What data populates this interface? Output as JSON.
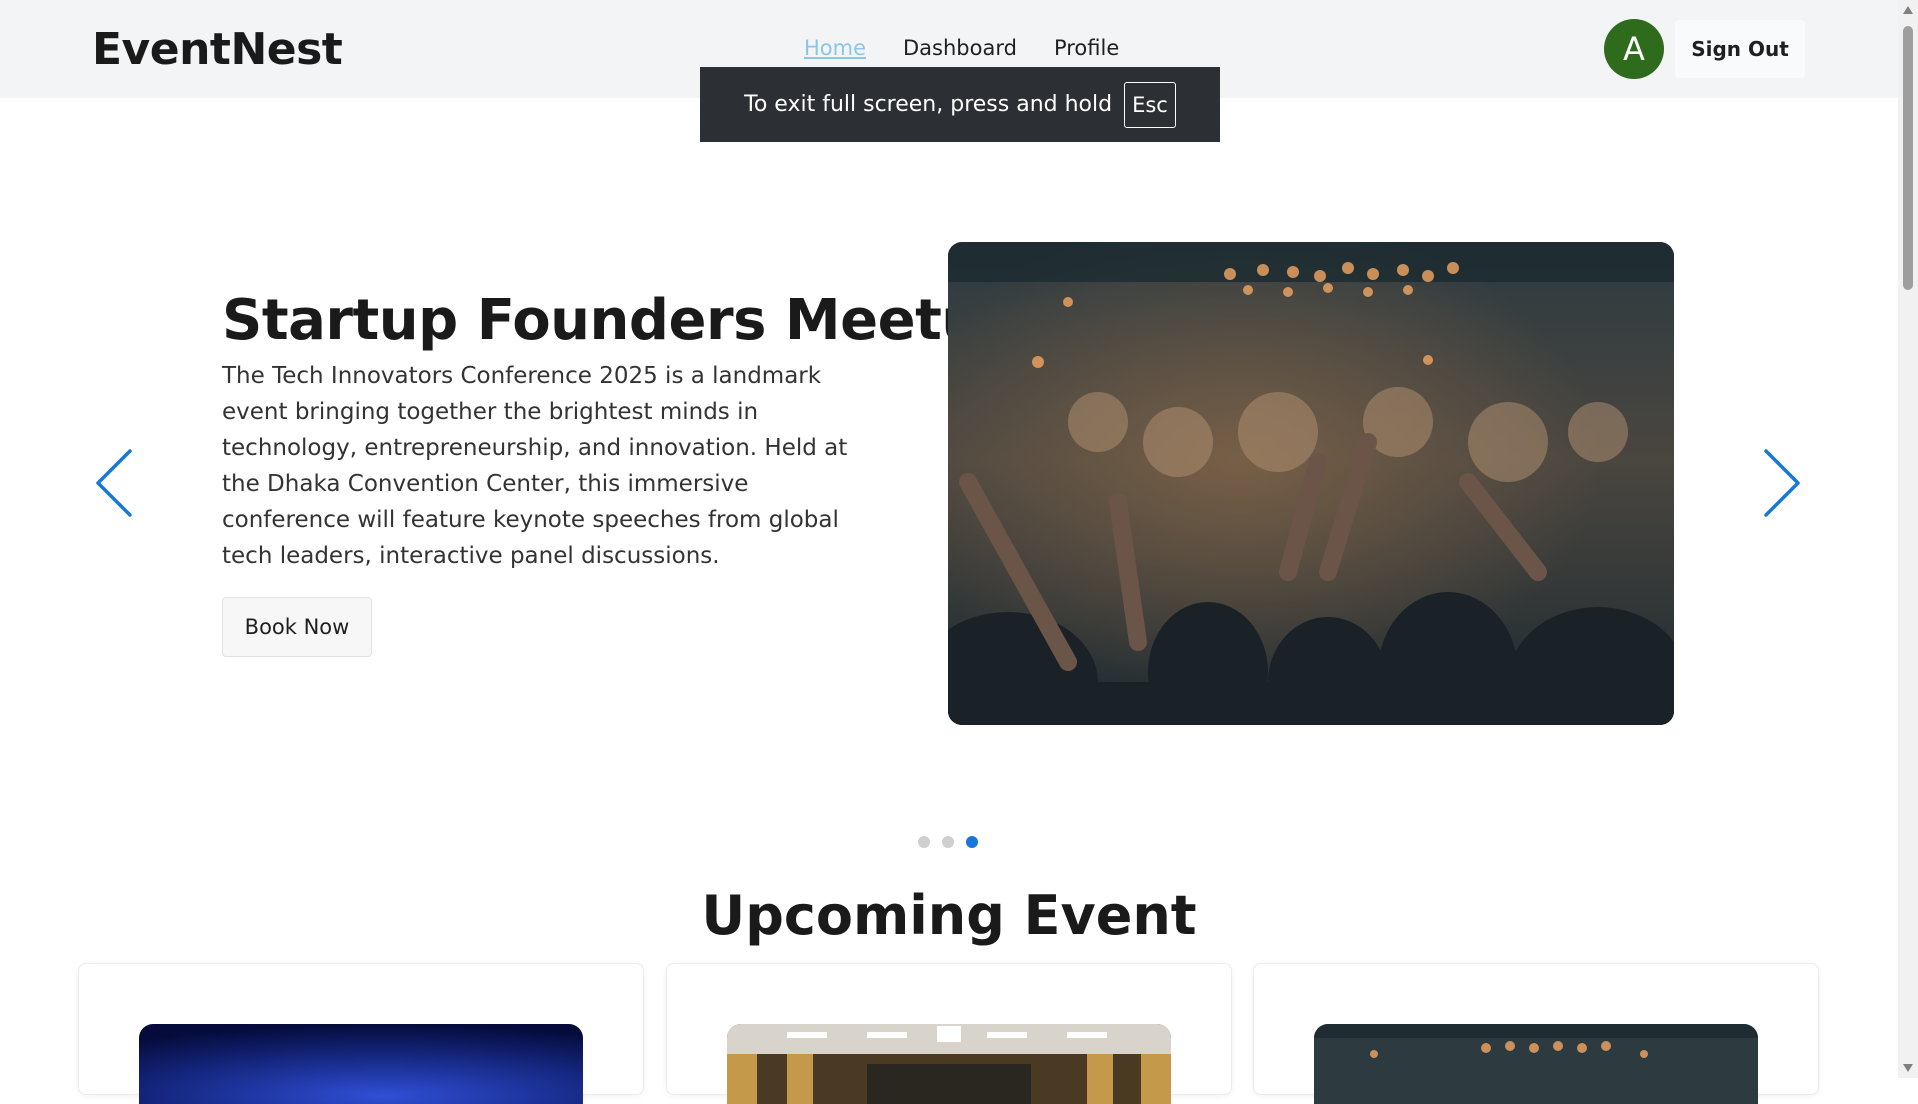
{
  "header": {
    "brand": "EventNest",
    "nav": [
      {
        "label": "Home",
        "active": true
      },
      {
        "label": "Dashboard",
        "active": false
      },
      {
        "label": "Profile",
        "active": false
      }
    ],
    "avatar_initial": "A",
    "sign_out_label": "Sign Out"
  },
  "fullscreen_notice": {
    "text": "To exit full screen, press and hold",
    "key": "Esc"
  },
  "carousel": {
    "title": "Startup Founders Meetup",
    "description": "The Tech Innovators Conference 2025 is a landmark event bringing together the brightest minds in technology, entrepreneurship, and innovation. Held at the Dhaka Convention Center, this immersive conference will feature keynote speeches from global tech leaders, interactive panel discussions.",
    "book_label": "Book Now",
    "slide_count": 3,
    "active_slide": 3,
    "prev_icon": "chevron-left-icon",
    "next_icon": "chevron-right-icon"
  },
  "upcoming": {
    "heading": "Upcoming Event",
    "cards": [
      {
        "image": "blue-gradient-image"
      },
      {
        "image": "conference-hall-image"
      },
      {
        "image": "concert-crowd-image"
      }
    ]
  },
  "colors": {
    "accent": "#1877d8",
    "avatar_bg": "#2e6b1d",
    "active_nav": "#8cc6e6",
    "header_bg": "#f3f4f6"
  }
}
